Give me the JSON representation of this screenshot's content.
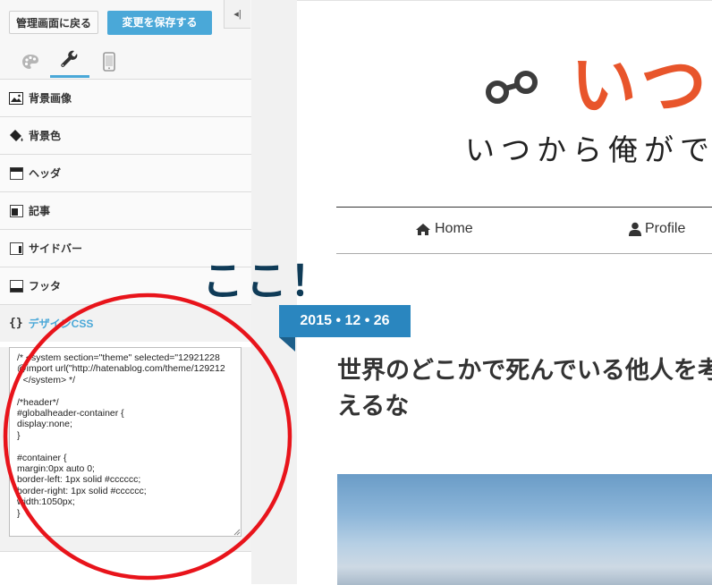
{
  "sidebar": {
    "back_label": "管理画面に戻る",
    "save_label": "変更を保存する",
    "collapse_glyph": "◂|",
    "tabs": [
      {
        "icon": "palette-icon"
      },
      {
        "icon": "wrench-icon"
      },
      {
        "icon": "mobile-icon"
      }
    ],
    "menu": [
      {
        "label": "背景画像",
        "icon": "image-icon"
      },
      {
        "label": "背景色",
        "icon": "paint-bucket-icon"
      },
      {
        "label": "ヘッダ",
        "icon": "header-layout-icon"
      },
      {
        "label": "記事",
        "icon": "article-layout-icon"
      },
      {
        "label": "サイドバー",
        "icon": "sidebar-layout-icon"
      },
      {
        "label": "フッタ",
        "icon": "footer-layout-icon"
      },
      {
        "label": "デザインCSS",
        "icon": "braces-icon",
        "brace": "{}"
      }
    ],
    "css_code": "/* <system section=\"theme\" selected=\"12921228\n@import url(\"http://hatenablog.com/theme/129212\n\" </system> */\n\n/*header*/\n#globalheader-container {\ndisplay:none;\n}\n\n#container {\nmargin:0px auto 0;\nborder-left: 1px solid #cccccc;\nborder-right: 1px solid #cccccc;\nwidth:1050px;\n}"
  },
  "blog": {
    "title": "いつか",
    "subtitle": "いつから俺ができ",
    "nav": [
      {
        "label": "Home",
        "icon": "home-icon"
      },
      {
        "label": "Profile",
        "icon": "user-icon"
      }
    ],
    "date": "2015 • 12 • 26",
    "post_title": "世界のどこかで死んでいる他人を考えるな"
  },
  "annotation": {
    "text": "ここ！"
  },
  "colors": {
    "accent": "#4aa8d8",
    "title_orange": "#e8552b",
    "date_badge": "#2a86bf",
    "annotation_red": "#e8141b",
    "annotation_text": "#0f3b57"
  }
}
